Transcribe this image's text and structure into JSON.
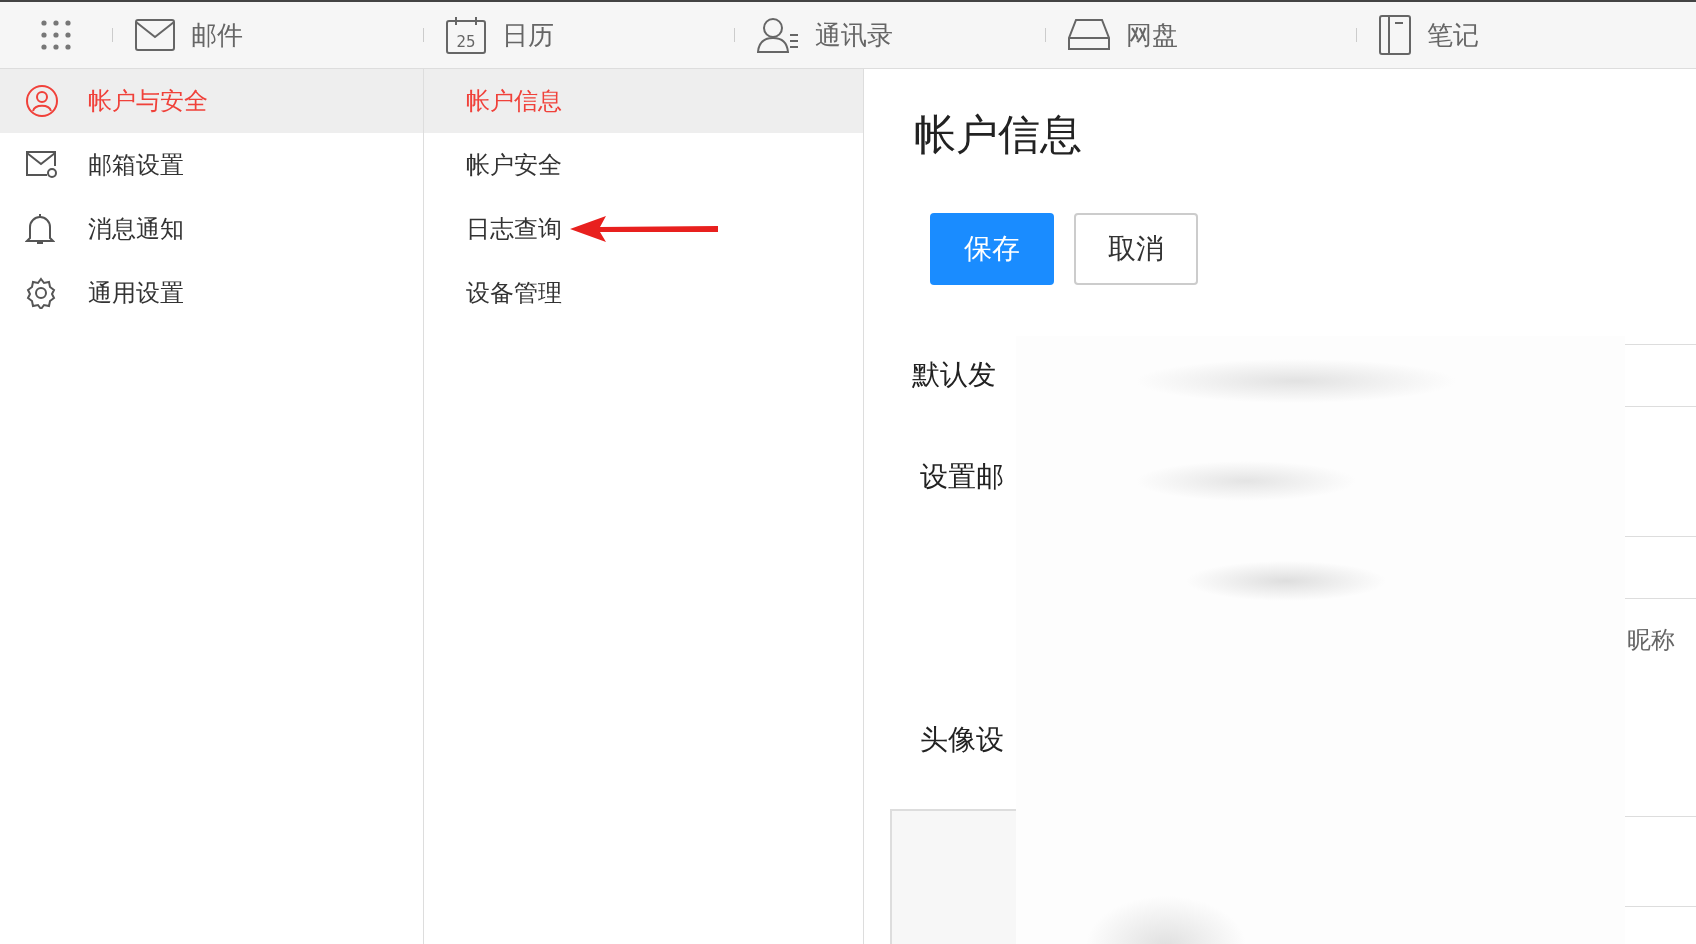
{
  "top_nav": {
    "items": [
      {
        "label": "邮件",
        "kind": "mail"
      },
      {
        "label": "日历",
        "kind": "calendar",
        "icon_text": "25"
      },
      {
        "label": "通讯录",
        "kind": "contacts"
      },
      {
        "label": "网盘",
        "kind": "drive"
      },
      {
        "label": "笔记",
        "kind": "notes"
      }
    ]
  },
  "sidebar": {
    "items": [
      {
        "label": "帐户与安全",
        "kind": "user",
        "selected": true
      },
      {
        "label": "邮箱设置",
        "kind": "mail-gear",
        "selected": false
      },
      {
        "label": "消息通知",
        "kind": "bell",
        "selected": false
      },
      {
        "label": "通用设置",
        "kind": "gear",
        "selected": false
      }
    ]
  },
  "submenu": {
    "items": [
      {
        "label": "帐户信息",
        "selected": true
      },
      {
        "label": "帐户安全",
        "selected": false
      },
      {
        "label": "日志查询",
        "selected": false
      },
      {
        "label": "设备管理",
        "selected": false
      }
    ]
  },
  "content": {
    "title": "帐户信息",
    "buttons": [
      {
        "label": "保存",
        "kind": "primary"
      },
      {
        "label": "取消",
        "kind": "secondary"
      }
    ],
    "fields": [
      {
        "label": "默认发"
      },
      {
        "label": "设置邮"
      },
      {
        "label": "头像设"
      }
    ],
    "side_text": "昵称"
  }
}
